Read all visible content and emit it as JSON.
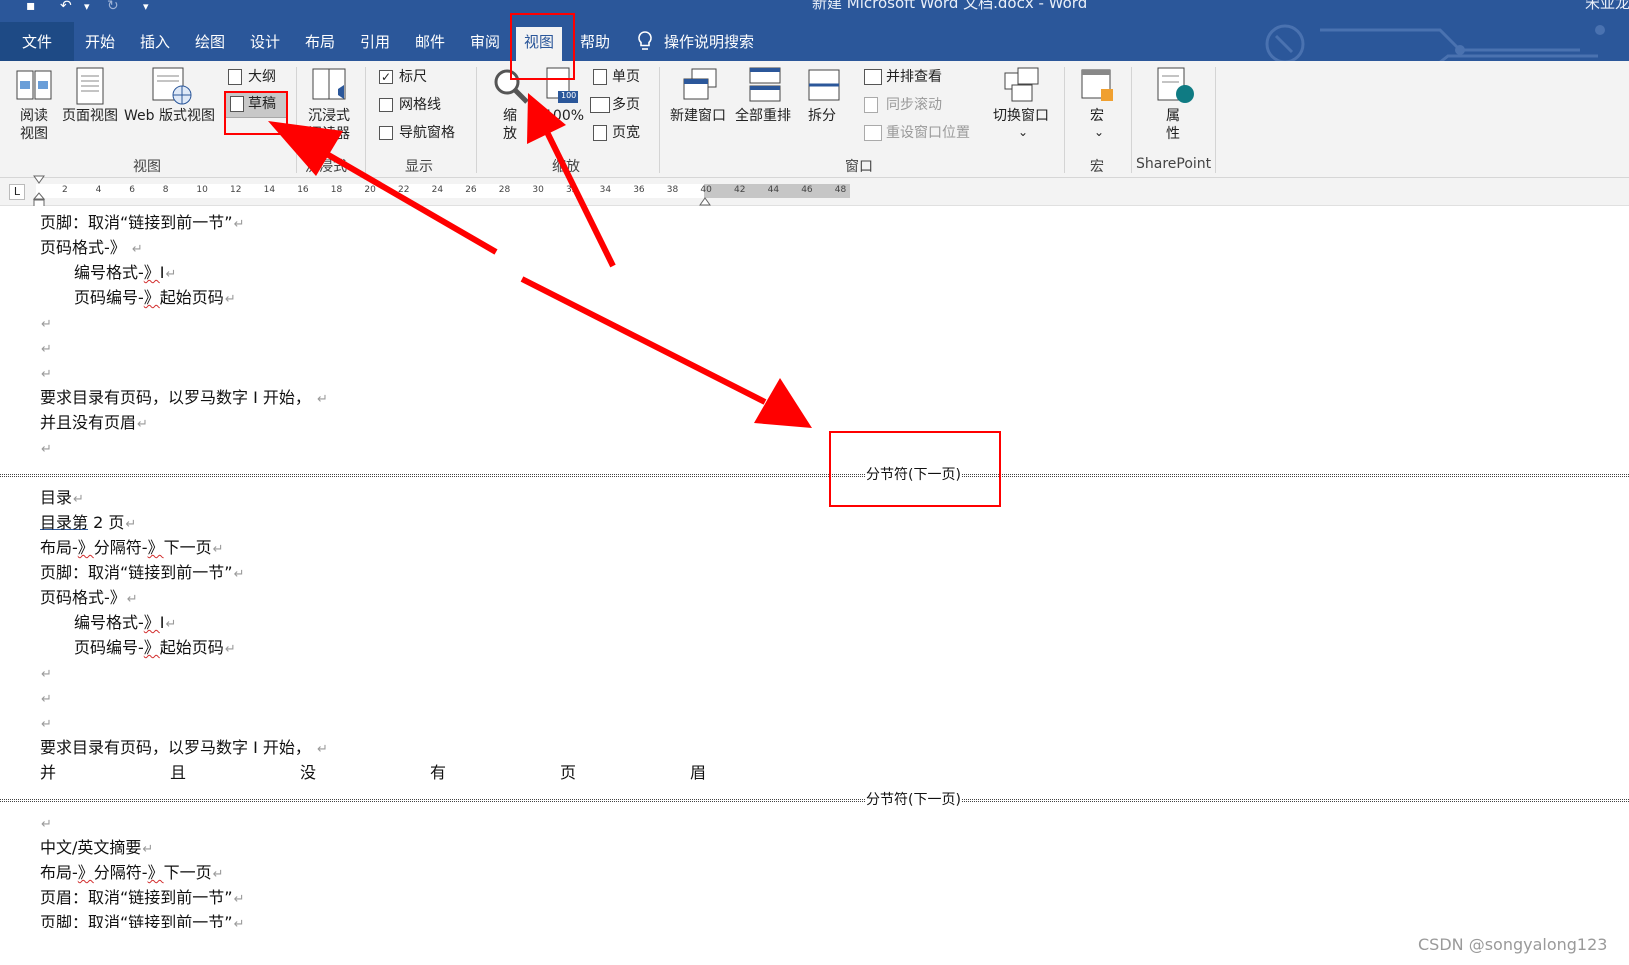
{
  "titlebar": {
    "title": "新建 Microsoft Word 文档.docx  -  Word",
    "user": "宋亚龙",
    "save_icon": "save-icon",
    "undo_icon": "undo-icon",
    "redo_icon": "redo-icon",
    "customize_icon": "customize-qat-icon"
  },
  "tabs": {
    "file": "文件",
    "home": "开始",
    "insert": "插入",
    "draw": "绘图",
    "design": "设计",
    "layout": "布局",
    "references": "引用",
    "mailings": "邮件",
    "review": "审阅",
    "view": "视图",
    "help": "帮助",
    "tellme": "操作说明搜索"
  },
  "ribbon": {
    "views": {
      "read_mode_1": "阅读",
      "read_mode_2": "视图",
      "print_layout": "页面视图",
      "web_layout": "Web 版式视图",
      "outline": "大纲",
      "draft": "草稿",
      "group": "视图"
    },
    "immersive": {
      "reader_1": "沉浸式",
      "reader_2": "阅读器",
      "group": "沉浸式"
    },
    "show": {
      "ruler": "标尺",
      "ruler_checked": "✓",
      "gridlines": "网格线",
      "nav_pane": "导航窗格",
      "group": "显示"
    },
    "zoom": {
      "zoom_1": "缩",
      "zoom_2": "放",
      "hundred": "100%",
      "hundred_badge": "100",
      "one_page": "单页",
      "multi_page": "多页",
      "page_width": "页宽",
      "group": "缩放"
    },
    "window": {
      "new_window": "新建窗口",
      "arrange_all": "全部重排",
      "split": "拆分",
      "side_by_side": "并排查看",
      "sync_scroll": "同步滚动",
      "reset_position": "重设窗口位置",
      "switch_windows": "切换窗口",
      "switch_caret": "⌄",
      "group": "窗口"
    },
    "macros": {
      "macros": "宏",
      "macros_caret": "⌄",
      "group": "宏"
    },
    "sharepoint": {
      "props_1": "属",
      "props_2": "性",
      "group": "SharePoint"
    }
  },
  "ruler": {
    "tab_selector": "L",
    "ticks": [
      "2",
      "4",
      "6",
      "8",
      "10",
      "12",
      "14",
      "16",
      "18",
      "20",
      "22",
      "24",
      "26",
      "28",
      "30",
      "32",
      "34",
      "36",
      "38",
      "40",
      "42",
      "44",
      "46",
      "48"
    ]
  },
  "doc": {
    "s1": {
      "l1": "页脚：取消“链接到前一节”",
      "l2": "页码格式-》",
      "l3a": "编号格式-",
      "l3b": "》",
      "l3c": "I",
      "l4a": "页码编号-",
      "l4b": "》",
      "l4c": "起始页码",
      "l8": "要求目录有页码，以罗马数字 I 开始，",
      "l9": "并且没有页眉"
    },
    "break1": "分节符(下一页)",
    "s2": {
      "l1": "目录",
      "l2a": "目录第",
      "l2b": " 2  页",
      "l3a": "布局-",
      "l3b": "》",
      "l3c": "分隔符-",
      "l3d": "》",
      "l3e": "下一页",
      "l4": "页脚：取消“链接到前一节”",
      "l5": "页码格式-》",
      "l6a": "编号格式-",
      "l6b": "》",
      "l6c": "I",
      "l7a": "页码编号-",
      "l7b": "》",
      "l7c": "起始页码",
      "l11": "要求目录有页码，以罗马数字 I 开始，",
      "j1": "并",
      "j2": "且",
      "j3": "没",
      "j4": "有",
      "j5": "页",
      "j6": "眉"
    },
    "break2": "分节符(下一页)",
    "s3": {
      "l2": "中文/英文摘要",
      "l3a": "布局-",
      "l3b": "》",
      "l3c": "分隔符-",
      "l3d": "》",
      "l3e": "下一页",
      "l4": "页眉：取消“链接到前一节”",
      "l5": "页脚：取消“链接到前一节”"
    },
    "para_mark": "↵"
  },
  "watermark": "CSDN @songyalong123",
  "colors": {
    "ribbon_blue": "#2b579a",
    "annotation_red": "#ff0000"
  }
}
